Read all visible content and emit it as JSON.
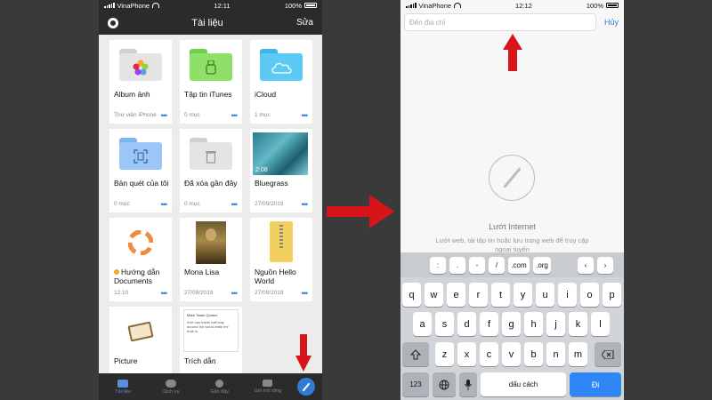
{
  "left": {
    "status": {
      "carrier": "VinaPhone",
      "time": "12:11",
      "battery": "100%"
    },
    "nav": {
      "title": "Tài liệu",
      "edit": "Sửa"
    },
    "items": [
      {
        "name": "Album ảnh",
        "meta": "Thư viện iPhone"
      },
      {
        "name": "Tập tin iTunes",
        "meta": "0 mục"
      },
      {
        "name": "iCloud",
        "meta": "1 mục"
      },
      {
        "name": "Bản quét của tôi",
        "meta": "0 mục"
      },
      {
        "name": "Đã xóa gần đây",
        "meta": "0 mục"
      },
      {
        "name": "Bluegrass",
        "meta": "27/09/2019",
        "duration": "2:08"
      },
      {
        "name": "Hướng dẫn Documents",
        "meta": "12:10"
      },
      {
        "name": "Mona Lisa",
        "meta": "27/09/2019"
      },
      {
        "name": "Nguồn Hello World",
        "meta": "27/09/2019"
      },
      {
        "name": "Picture",
        "meta": ""
      },
      {
        "name": "Trích dẫn",
        "meta": "",
        "preview_title": "Mark Twain Quotes",
        "preview_text": "A lie can travel half way around the world while the truth is"
      }
    ],
    "tabs": [
      "Tài liệu",
      "Dịch vụ",
      "Gần đây",
      "Gói mở rộng"
    ],
    "more_dots": "•••"
  },
  "right": {
    "status": {
      "carrier": "VinaPhone",
      "time": "12:12",
      "battery": "100%"
    },
    "address_placeholder": "Đến địa chỉ",
    "cancel": "Hủy",
    "browse_title": "Lướt Internet",
    "browse_desc": "Lướt web, tải tập tin hoặc lưu trang web để truy cập ngoại tuyến",
    "shortcuts": [
      ":",
      ".",
      "-",
      "/",
      ".com",
      ".org"
    ],
    "row1": [
      "q",
      "w",
      "e",
      "r",
      "t",
      "y",
      "u",
      "i",
      "o",
      "p"
    ],
    "row2": [
      "a",
      "s",
      "d",
      "f",
      "g",
      "h",
      "j",
      "k",
      "l"
    ],
    "row3": [
      "z",
      "x",
      "c",
      "v",
      "b",
      "n",
      "m"
    ],
    "numbers_key": "123",
    "space_key": "dấu cách",
    "go_key": "Đi"
  },
  "colors": {
    "accent": "#2f7bd6",
    "arrow": "#d8141b",
    "dark_bar": "#2b2b2b"
  }
}
